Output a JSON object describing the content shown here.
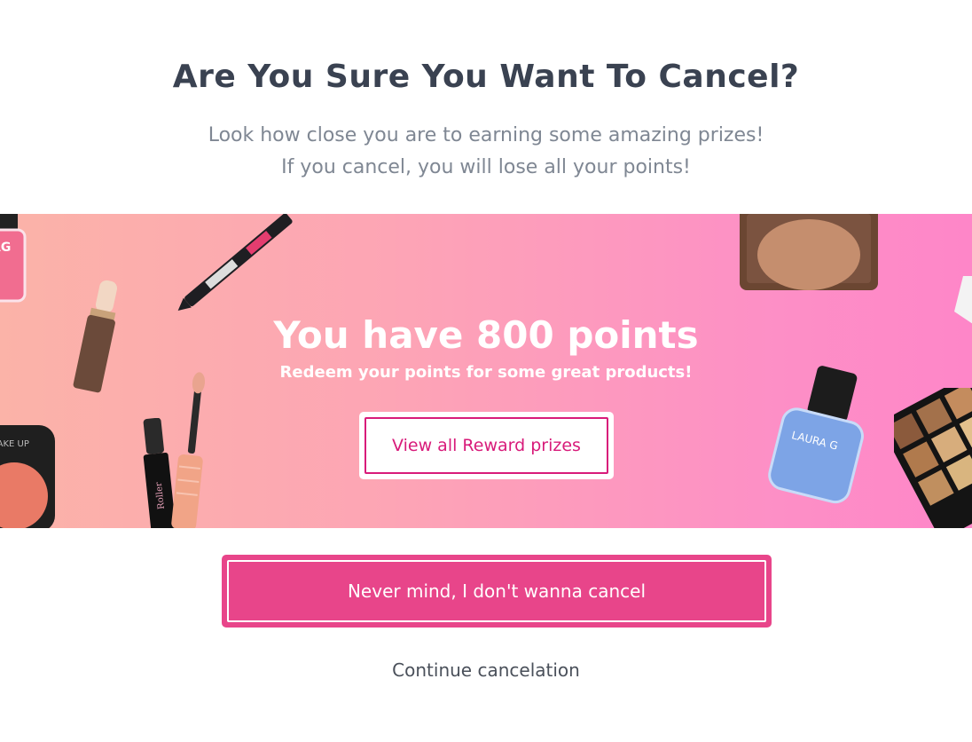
{
  "header": {
    "title": "Are You Sure You Want To Cancel?",
    "subtitle_line1": "Look how close you are to earning some amazing prizes!",
    "subtitle_line2": "If you cancel, you will lose all your points!"
  },
  "banner": {
    "points_title": "You have 800 points",
    "points_subtitle": "Redeem your points for some great products!",
    "reward_button_label": "View all Reward prizes",
    "product_icons": [
      "nail-polish-icon",
      "foundation-stick-icon",
      "eyeliner-pen-icon",
      "mascara-icon",
      "lip-gloss-icon",
      "compact-powder-icon",
      "bronzer-compact-icon",
      "eyeshadow-palette-icon",
      "blue-nail-polish-icon"
    ],
    "colors": {
      "gradient_start": "#fbb3a8",
      "gradient_end": "#fe86c8",
      "accent": "#d81b7a"
    }
  },
  "actions": {
    "stay_button_label": "Never mind, I don't wanna cancel",
    "continue_link_label": "Continue cancelation",
    "stay_button_color": "#e8458a"
  }
}
